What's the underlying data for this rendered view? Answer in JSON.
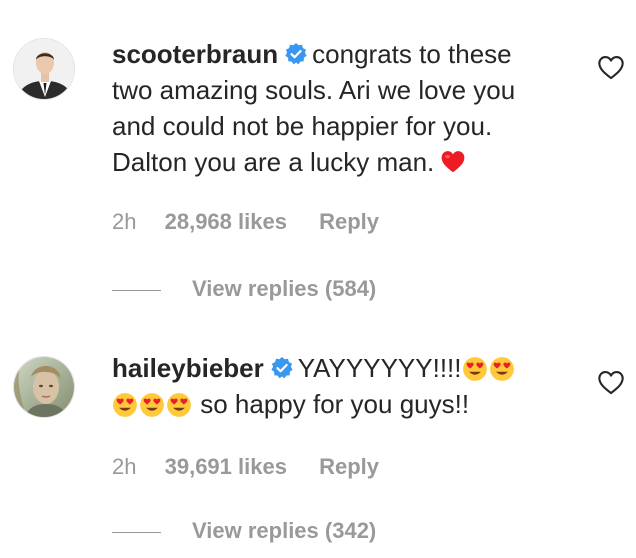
{
  "comments": [
    {
      "username": "scooterbraun",
      "verified": true,
      "text_lines": [
        "congrats to these",
        "two amazing souls. Ari we love you",
        "and could not be happier for you.",
        "Dalton you are a lucky man."
      ],
      "trailing_emoji": "red-heart",
      "time": "2h",
      "likes": "28,968 likes",
      "reply_label": "Reply",
      "view_replies": "View replies (584)",
      "avatar": "man-in-suit-avatar"
    },
    {
      "username": "haileybieber",
      "verified": true,
      "text_line1": "YAYYYYYY!!!!",
      "text_line2": "so happy for you guys!!",
      "emoji": "smiling-face-with-heart-eyes",
      "time": "2h",
      "likes": "39,691 likes",
      "reply_label": "Reply",
      "view_replies": "View replies (342)",
      "avatar": "woman-portrait-avatar"
    }
  ],
  "colors": {
    "text": "#262626",
    "muted": "#999999",
    "verified_blue": "#3897f0",
    "heart_red": "#ed1c24",
    "emoji_yellow": "#ffc93a"
  }
}
